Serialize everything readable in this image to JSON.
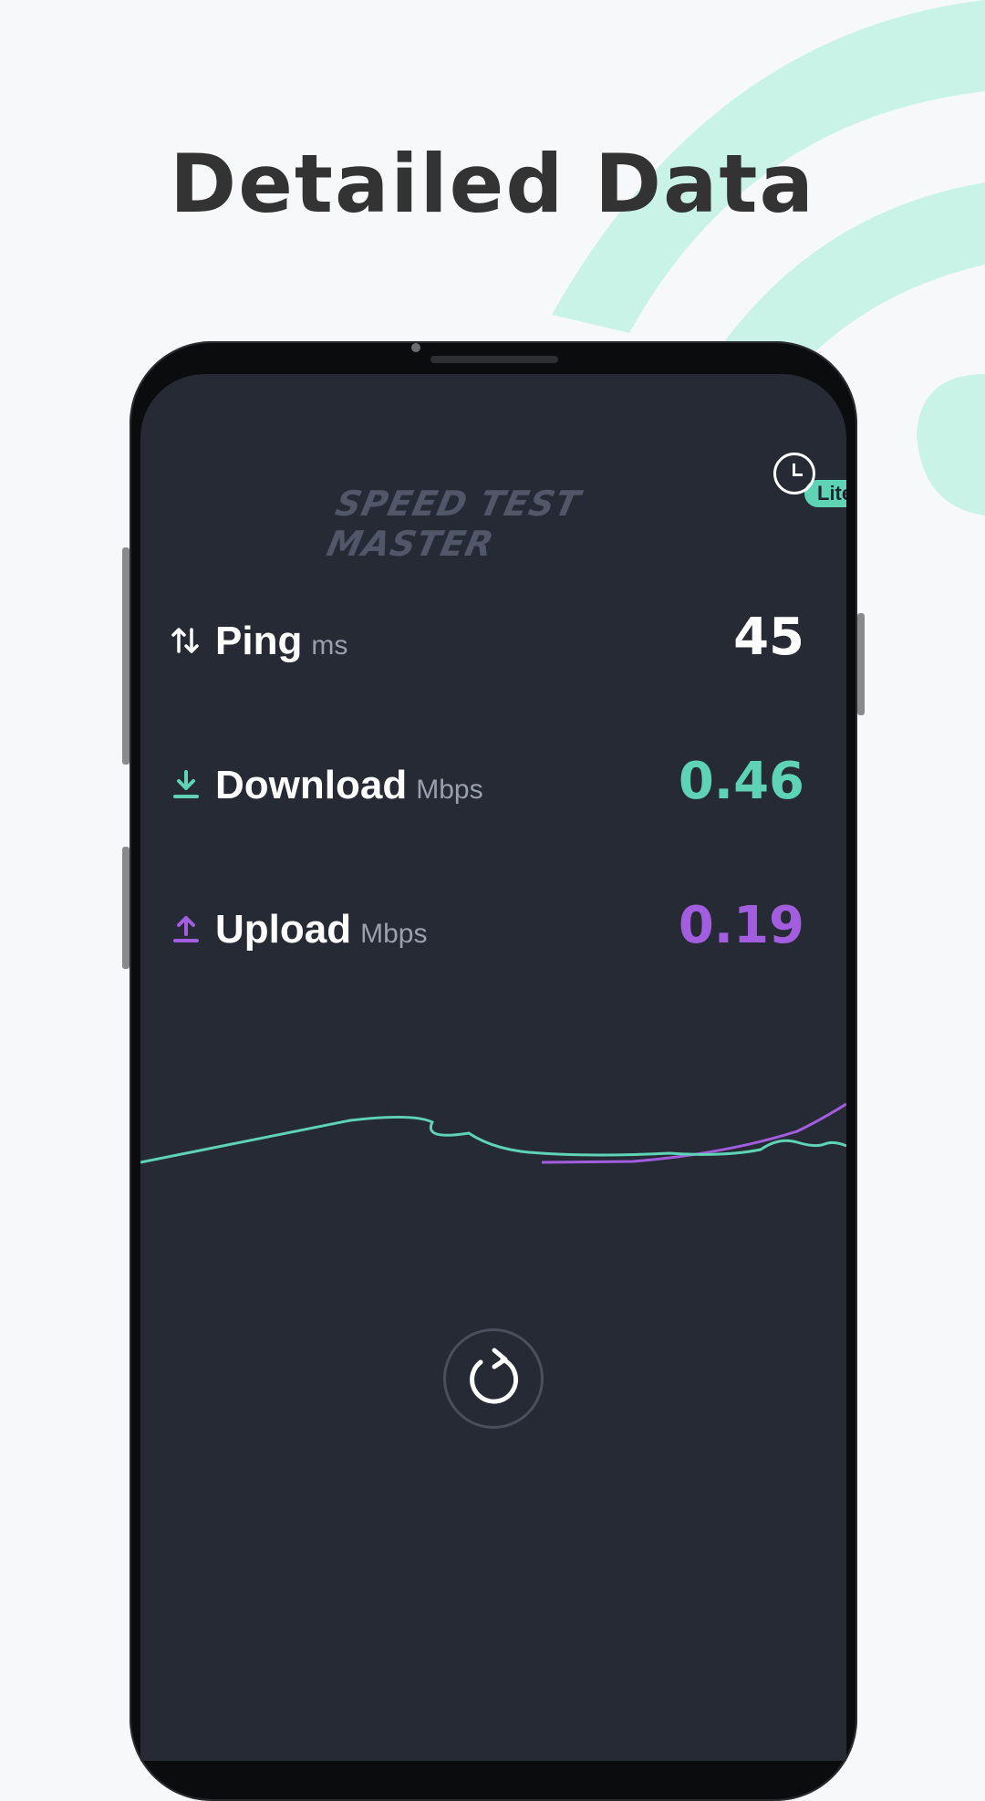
{
  "headline": "Detailed Data",
  "app": {
    "logo_text": "SPEED TEST MASTER",
    "badge": "Lite"
  },
  "metrics": {
    "ping": {
      "label": "Ping",
      "unit": "ms",
      "value": "45",
      "color": "#ffffff",
      "icon": "ping-arrows-icon"
    },
    "download": {
      "label": "Download",
      "unit": "Mbps",
      "value": "0.46",
      "color": "#5fd3b6",
      "icon": "download-icon"
    },
    "upload": {
      "label": "Upload",
      "unit": "Mbps",
      "value": "0.19",
      "color": "#a35ee0",
      "icon": "upload-icon"
    }
  },
  "colors": {
    "screen_bg": "#262a35",
    "download_line": "#5fd3b6",
    "upload_line": "#a35ee0",
    "accent_deco": "#c6f2e6"
  }
}
